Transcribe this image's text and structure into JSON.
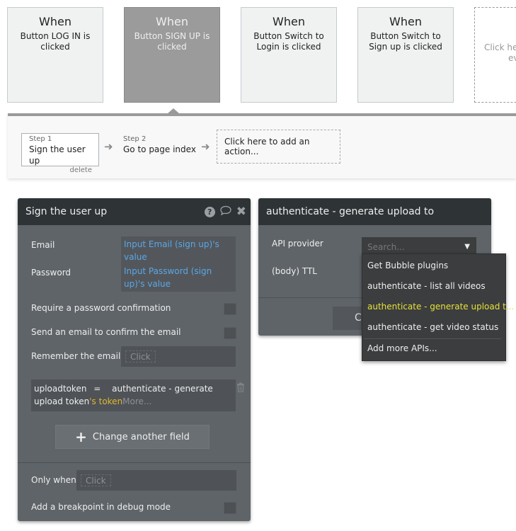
{
  "events": [
    {
      "when": "When",
      "desc": "Button LOG IN is clicked",
      "selected": false
    },
    {
      "when": "When",
      "desc": "Button SIGN UP is clicked",
      "selected": true
    },
    {
      "when": "When",
      "desc": "Button Switch to Login is clicked",
      "selected": false
    },
    {
      "when": "When",
      "desc": "Button Switch to Sign up is clicked",
      "selected": false
    }
  ],
  "add_event": {
    "line1": "Click here to add an",
    "line2": "event..."
  },
  "steps": [
    {
      "num": "Step 1",
      "title": "Sign the user up",
      "delete": "delete"
    },
    {
      "num": "Step 2",
      "title": "Go to page index"
    }
  ],
  "add_action": "Click here to add an action...",
  "signup_panel": {
    "title": "Sign the user up",
    "icons": {
      "help": "?",
      "comment": "comment-icon",
      "close": "✖"
    },
    "email_label": "Email",
    "email_value": "Input Email (sign up)'s value",
    "password_label": "Password",
    "password_value": "Input Password (sign up)'s value",
    "require_confirm_label": "Require a password confirmation",
    "send_email_label": "Send an email to confirm the email",
    "remember_label": "Remember the email",
    "remember_placeholder": "Click",
    "assignment": {
      "field": "uploadtoken",
      "op": "=",
      "expr_main": "authenticate - generate upload token",
      "expr_suffix": "'s token",
      "more": "More..."
    },
    "change_field_label": "Change another field",
    "only_when_label": "Only when",
    "only_when_placeholder": "Click",
    "breakpoint_label": "Add a breakpoint in debug mode"
  },
  "api_panel": {
    "title": "authenticate - generate upload to",
    "api_provider_label": "API provider",
    "search_placeholder": "Search...",
    "ttl_label": "(body) TTL",
    "button_partial": "C",
    "dropdown": [
      {
        "label": "Get Bubble plugins",
        "selected": false
      },
      {
        "label": "authenticate - list all videos",
        "selected": false
      },
      {
        "label": "authenticate - generate upload t...",
        "selected": true
      },
      {
        "label": "authenticate - get video status",
        "selected": false
      },
      {
        "label": "Add more APIs...",
        "selected": false
      }
    ]
  },
  "colors": {
    "link_blue": "#5aa7e8",
    "highlight_yellow": "#e2b72f",
    "selected_option": "#e6e035",
    "panel_bg": "#5f6468",
    "panel_header": "#2e3336"
  }
}
